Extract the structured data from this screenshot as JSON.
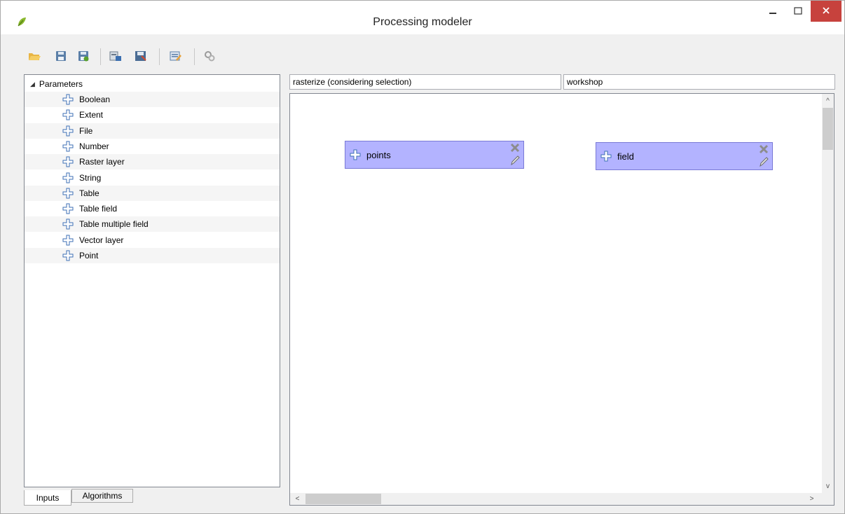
{
  "window": {
    "title": "Processing modeler",
    "icons": {
      "app": "qgis-leaf-icon",
      "minimize": "minimize-icon",
      "maximize": "maximize-icon",
      "close": "close-icon"
    },
    "close_color": "#c7423d"
  },
  "toolbar": {
    "buttons": [
      {
        "name": "open-model",
        "icon": "folder-open-icon"
      },
      {
        "name": "save-model",
        "icon": "floppy-disk-icon"
      },
      {
        "name": "save-model-as",
        "icon": "floppy-disk-as-icon"
      },
      {
        "name": "export-image",
        "icon": "export-image-icon"
      },
      {
        "name": "export-python",
        "icon": "export-script-icon"
      },
      {
        "name": "edit-help",
        "icon": "edit-help-icon"
      },
      {
        "name": "run-model",
        "icon": "run-gears-icon"
      }
    ]
  },
  "inputs_tree": {
    "root_label": "Parameters",
    "items": [
      "Boolean",
      "Extent",
      "File",
      "Number",
      "Raster layer",
      "String",
      "Table",
      "Table field",
      "Table multiple field",
      "Vector layer",
      "Point"
    ]
  },
  "tabs": {
    "inputs": "Inputs",
    "algorithms": "Algorithms",
    "active": "Inputs"
  },
  "model": {
    "name": "rasterize (considering selection)",
    "group": "workshop"
  },
  "canvas": {
    "nodes": [
      {
        "label": "points"
      },
      {
        "label": "field"
      }
    ],
    "node_color": "#b3b3ff"
  },
  "scroll_arrows": {
    "up": "^",
    "down": "v",
    "left": "<",
    "right": ">"
  }
}
